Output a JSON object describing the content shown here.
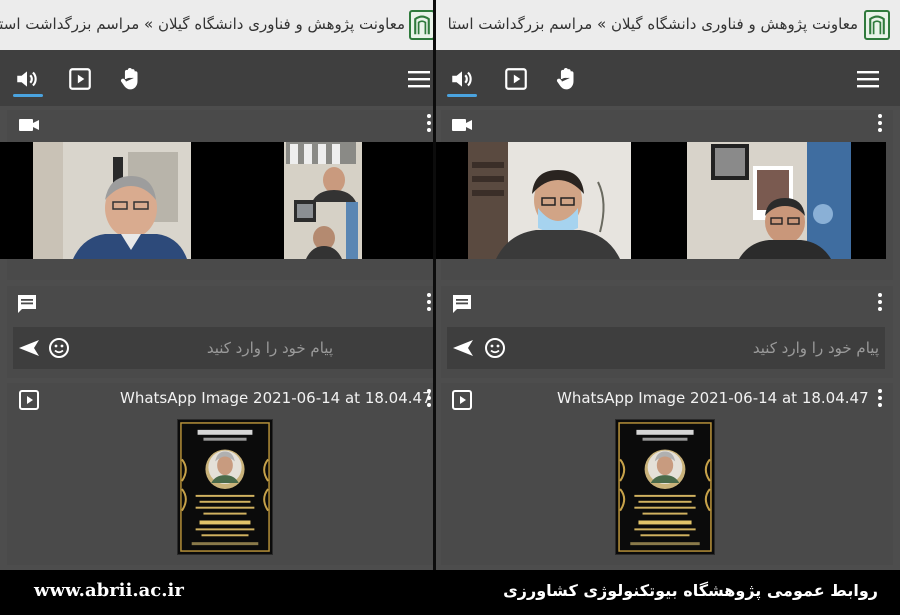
{
  "left": {
    "title": "معاونت پژوهش و فناوری دانشگاه گیلان » مراسم بزرگداشت استا",
    "chat_placeholder": "پیام خود را وارد کنید",
    "file_name": "WhatsApp Image 2021-06-14 at 18.04.47"
  },
  "right": {
    "title": "معاونت پژوهش و فناوری دانشگاه گیلان » مراسم بزرگداشت استا",
    "chat_placeholder": "پیام خود را وارد کنید",
    "file_name": "WhatsApp Image 2021-06-14 at 18.04.47"
  },
  "icons": {
    "audio": "speaker-icon",
    "present": "play-box-icon",
    "raise_hand": "hand-icon",
    "menu": "hamburger-icon",
    "camera": "video-camera-icon",
    "chat": "chat-bubble-icon",
    "more": "kebab-icon",
    "send": "send-icon",
    "emoji": "smiley-icon",
    "file": "play-box-icon"
  },
  "colors": {
    "accent": "#4aa3df",
    "logo_green": "#2f7a3c",
    "panel_bg": "#4d4d4d"
  },
  "footer": {
    "url": "www.abrii.ac.ir",
    "org": "روابط عمومی پژوهشگاه بیوتکنولوژی کشاورزی"
  }
}
